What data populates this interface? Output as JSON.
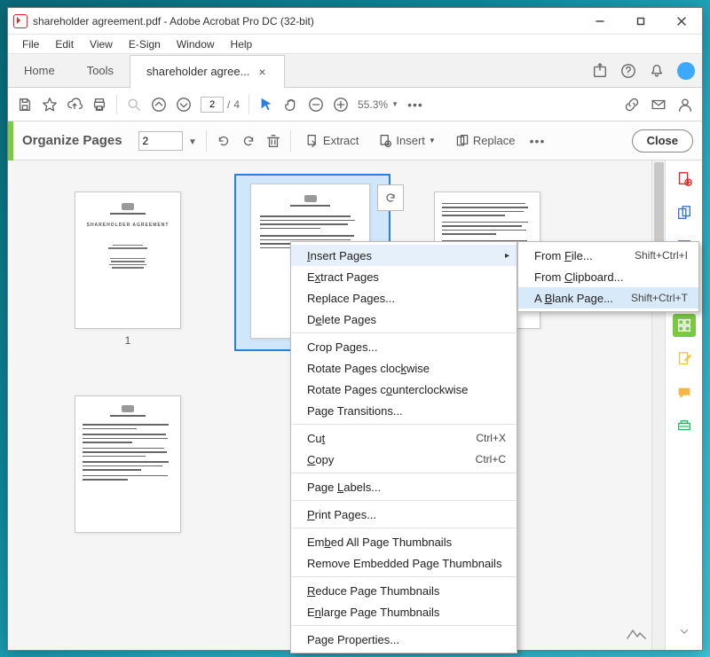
{
  "window": {
    "title": "shareholder agreement.pdf - Adobe Acrobat Pro DC (32-bit)"
  },
  "menu": [
    "File",
    "Edit",
    "View",
    "E-Sign",
    "Window",
    "Help"
  ],
  "tabs": {
    "home": "Home",
    "tools": "Tools",
    "file": "shareholder agree..."
  },
  "toolbar": {
    "current_page": "2",
    "total_pages": "4",
    "page_sep": "/",
    "zoom": "55.3%",
    "more": "•••"
  },
  "organize": {
    "title": "Organize Pages",
    "page_input": "2",
    "extract": "Extract",
    "insert": "Insert",
    "replace": "Replace",
    "close": "Close"
  },
  "thumbs": {
    "page1_label": "1",
    "page1_title": "SHAREHOLDER AGREEMENT"
  },
  "context_menu": {
    "insert_pages": "Insert Pages",
    "extract_pages": "Extract Pages",
    "replace_pages": "Replace Pages...",
    "delete_pages": "Delete Pages",
    "crop_pages": "Crop Pages...",
    "rotate_cw": "Rotate Pages clockwise",
    "rotate_ccw": "Rotate Pages counterclockwise",
    "page_transitions": "Page Transitions...",
    "cut": "Cut",
    "cut_shortcut": "Ctrl+X",
    "copy": "Copy",
    "copy_shortcut": "Ctrl+C",
    "page_labels": "Page Labels...",
    "print_pages": "Print Pages...",
    "embed_all": "Embed All Page Thumbnails",
    "remove_embedded": "Remove Embedded Page Thumbnails",
    "reduce": "Reduce Page Thumbnails",
    "enlarge": "Enlarge Page Thumbnails",
    "page_properties": "Page Properties..."
  },
  "submenu": {
    "from_file": "From File...",
    "from_file_shortcut": "Shift+Ctrl+I",
    "from_clipboard": "From Clipboard...",
    "blank_page": "A Blank Page...",
    "blank_page_shortcut": "Shift+Ctrl+T"
  }
}
